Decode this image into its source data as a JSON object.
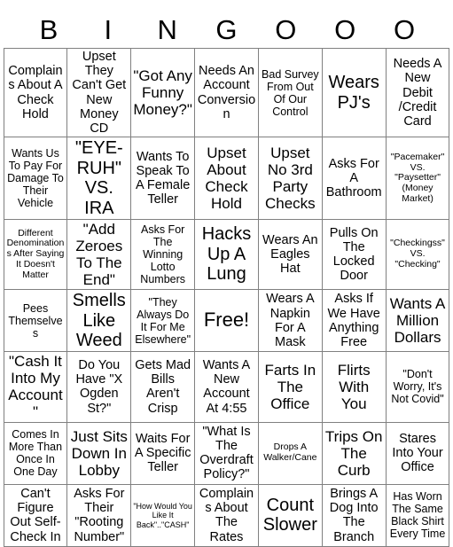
{
  "card": {
    "title": "Bingo Card",
    "header_letters": [
      "B",
      "I",
      "N",
      "G",
      "O",
      "O",
      "O"
    ],
    "columns": 7,
    "rows": 7,
    "free_space": "Free!",
    "border_color": "#808080",
    "text_color": "#000000",
    "background_color": "#ffffff",
    "cells": [
      [
        {
          "text": "Complains About A Check Hold",
          "size": "fs-md"
        },
        {
          "text": "Upset They Can't Get New Money CD",
          "size": "fs-md"
        },
        {
          "text": "\"Got Any Funny Money?\"",
          "size": "fs-lg"
        },
        {
          "text": "Needs An Account Conversion",
          "size": "fs-md"
        },
        {
          "text": "Bad Survey From Out Of Our Control",
          "size": "fs-sm"
        },
        {
          "text": "Wears PJ's",
          "size": "fs-xl"
        },
        {
          "text": "Needs A New Debit /Credit Card",
          "size": "fs-md"
        }
      ],
      [
        {
          "text": "Wants Us To Pay For Damage To Their Vehicle",
          "size": "fs-sm"
        },
        {
          "text": "\"EYE-RUH\" VS. IRA",
          "size": "fs-xl"
        },
        {
          "text": "Wants To Speak To A Female Teller",
          "size": "fs-md"
        },
        {
          "text": "Upset About Check Hold",
          "size": "fs-lg"
        },
        {
          "text": "Upset No 3rd Party Checks",
          "size": "fs-lg"
        },
        {
          "text": "Asks For A Bathroom",
          "size": "fs-md"
        },
        {
          "text": "\"Pacemaker\" VS. \"Paysetter\" (Money Market)",
          "size": "fs-xs"
        }
      ],
      [
        {
          "text": "Different Denominations After Saying It Doesn't Matter",
          "size": "fs-xs"
        },
        {
          "text": "\"Add Zeroes To The End\"",
          "size": "fs-lg"
        },
        {
          "text": "Asks For The Winning Lotto Numbers",
          "size": "fs-sm"
        },
        {
          "text": "Hacks Up A Lung",
          "size": "fs-xl"
        },
        {
          "text": "Wears An Eagles Hat",
          "size": "fs-md"
        },
        {
          "text": "Pulls On The Locked Door",
          "size": "fs-md"
        },
        {
          "text": "\"Checkingss\" VS. \"Checking\"",
          "size": "fs-xs"
        }
      ],
      [
        {
          "text": "Pees Themselves",
          "size": "fs-sm"
        },
        {
          "text": "Smells Like Weed",
          "size": "fs-xl"
        },
        {
          "text": "\"They Always Do It For Me Elsewhere\"",
          "size": "fs-sm"
        },
        {
          "text": "Free!",
          "size": "free"
        },
        {
          "text": "Wears A Napkin For A Mask",
          "size": "fs-md"
        },
        {
          "text": "Asks If We Have Anything Free",
          "size": "fs-md"
        },
        {
          "text": "Wants A Million Dollars",
          "size": "fs-lg"
        }
      ],
      [
        {
          "text": "\"Cash It Into My Account\"",
          "size": "fs-lg"
        },
        {
          "text": "Do You Have \"X Ogden St?\"",
          "size": "fs-md"
        },
        {
          "text": "Gets Mad Bills Aren't Crisp",
          "size": "fs-md"
        },
        {
          "text": "Wants A New Account At 4:55",
          "size": "fs-md"
        },
        {
          "text": "Farts In The Office",
          "size": "fs-lg"
        },
        {
          "text": "Flirts With You",
          "size": "fs-lg"
        },
        {
          "text": "\"Don't Worry, It's Not Covid\"",
          "size": "fs-sm"
        }
      ],
      [
        {
          "text": "Comes In More Than Once In One Day",
          "size": "fs-sm"
        },
        {
          "text": "Just Sits Down In Lobby",
          "size": "fs-lg"
        },
        {
          "text": "Waits For A Specific Teller",
          "size": "fs-md"
        },
        {
          "text": "\"What Is The Overdraft Policy?\"",
          "size": "fs-md"
        },
        {
          "text": "Drops A Walker/Cane",
          "size": "fs-xs"
        },
        {
          "text": "Trips On The Curb",
          "size": "fs-lg"
        },
        {
          "text": "Stares Into Your Office",
          "size": "fs-md"
        }
      ],
      [
        {
          "text": "Can't Figure Out Self-Check In",
          "size": "fs-md"
        },
        {
          "text": "Asks For Their \"Rooting Number\"",
          "size": "fs-md"
        },
        {
          "text": "\"How Would You Like It Back\"..\"CASH\"",
          "size": "fs-xxs"
        },
        {
          "text": "Complains About The Rates",
          "size": "fs-md"
        },
        {
          "text": "Count Slower",
          "size": "fs-xl"
        },
        {
          "text": "Brings A Dog Into The Branch",
          "size": "fs-md"
        },
        {
          "text": "Has Worn The Same Black Shirt Every Time",
          "size": "fs-sm"
        }
      ]
    ]
  }
}
